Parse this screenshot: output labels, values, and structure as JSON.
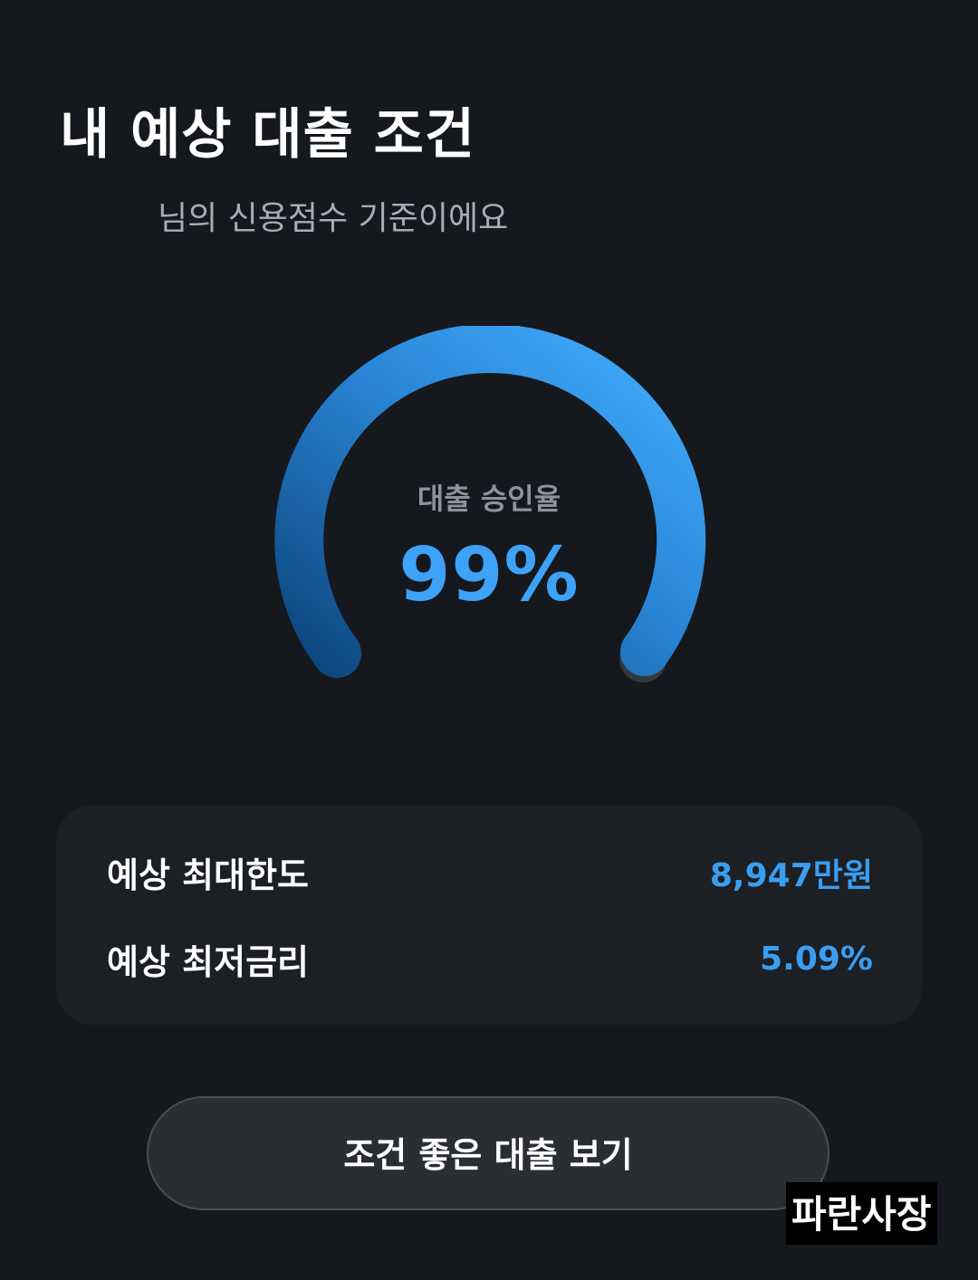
{
  "header": {
    "title": "내 예상 대출 조건",
    "subtitle": "님의 신용점수 기준이에요"
  },
  "gauge": {
    "label": "대출 승인율",
    "value_text": "99%",
    "value_fraction": 0.99,
    "colors": {
      "start": "#0d467f",
      "end": "#3fa9fc",
      "track_cap": "#3a3d42"
    }
  },
  "summary": {
    "rows": [
      {
        "label": "예상 최대한도",
        "value": "8,947만원"
      },
      {
        "label": "예상 최저금리",
        "value": "5.09%"
      }
    ]
  },
  "cta": {
    "label": "조건 좋은 대출 보기"
  },
  "watermark": {
    "text": "파란사장"
  },
  "colors": {
    "background": "#15181d",
    "card": "#1c1f24",
    "accent": "#3a9ef0",
    "button": "#2a2d31"
  }
}
